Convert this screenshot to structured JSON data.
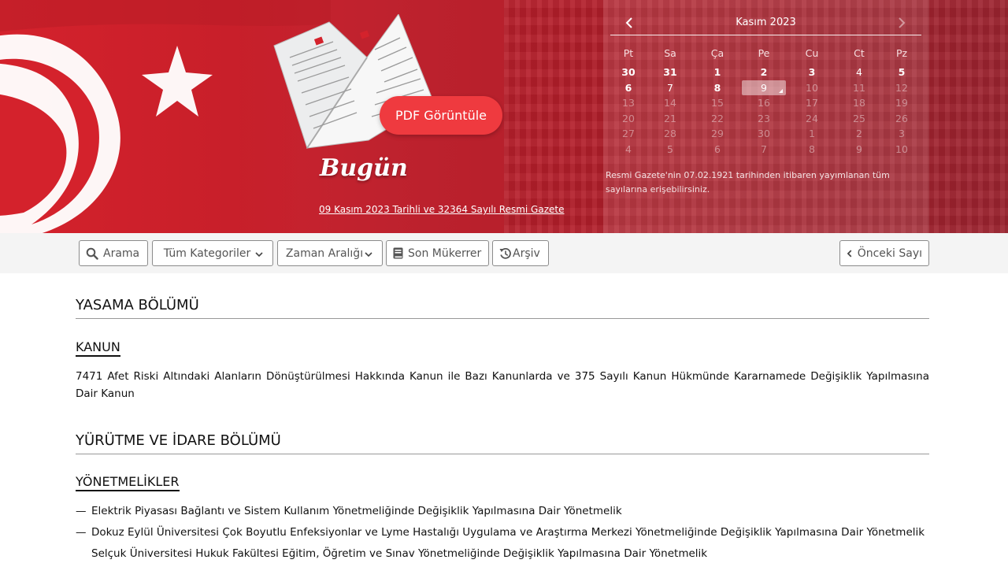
{
  "hero": {
    "pdf_button": "PDF Görüntüle",
    "today_label": "Bugün",
    "gazette_link": "09 Kasım 2023 Tarihli ve 32364 Sayılı Resmi Gazete"
  },
  "calendar": {
    "title": "Kasım 2023",
    "weekdays": [
      "Pt",
      "Sa",
      "Ça",
      "Pe",
      "Cu",
      "Ct",
      "Pz"
    ],
    "weeks": [
      [
        "30",
        "31",
        "1",
        "2",
        "3",
        "4",
        "5"
      ],
      [
        "6",
        "7",
        "8",
        "9",
        "10",
        "11",
        "12"
      ],
      [
        "13",
        "14",
        "15",
        "16",
        "17",
        "18",
        "19"
      ],
      [
        "20",
        "21",
        "22",
        "23",
        "24",
        "25",
        "26"
      ],
      [
        "27",
        "28",
        "29",
        "30",
        "1",
        "2",
        "3"
      ],
      [
        "4",
        "5",
        "6",
        "7",
        "8",
        "9",
        "10"
      ]
    ],
    "selected_day": "9",
    "note": "Resmi Gazete'nin 07.02.1921 tarihinden itibaren yayımlanan tüm sayılarına erişebilirsiniz."
  },
  "toolbar": {
    "search": "Arama",
    "categories": "Tüm Kategoriler",
    "time_range": "Zaman Aralığı",
    "last_repeated": "Son Mükerrer",
    "archive": "Arşiv",
    "previous_issue": "Önceki Sayı"
  },
  "content": {
    "legislation_title": "YASAMA BÖLÜMÜ",
    "law_heading": "KANUN",
    "law_text": "7471 Afet Riski Altındaki Alanların Dönüştürülmesi Hakkında Kanun ile Bazı Kanunlarda ve 375 Sayılı Kanun Hükmünde Kararnamede Değişiklik Yapılmasına Dair Kanun",
    "executive_title": "YÜRÜTME VE İDARE BÖLÜMÜ",
    "regulations_heading": "YÖNETMELİKLER",
    "regulations": [
      "Elektrik Piyasası Bağlantı ve Sistem Kullanım Yönetmeliğinde Değişiklik Yapılmasına Dair Yönetmelik",
      "Dokuz Eylül Üniversitesi Çok Boyutlu Enfeksiyonlar ve Lyme Hastalığı Uygulama ve Araştırma Merkezi Yönetmeliğinde Değişiklik Yapılmasına Dair Yönetmelik",
      "Selçuk Üniversitesi Hukuk Fakültesi Eğitim, Öğretim ve Sınav Yönetmeliğinde Değişiklik Yapılmasına Dair Yönetmelik"
    ],
    "dash": "—"
  }
}
